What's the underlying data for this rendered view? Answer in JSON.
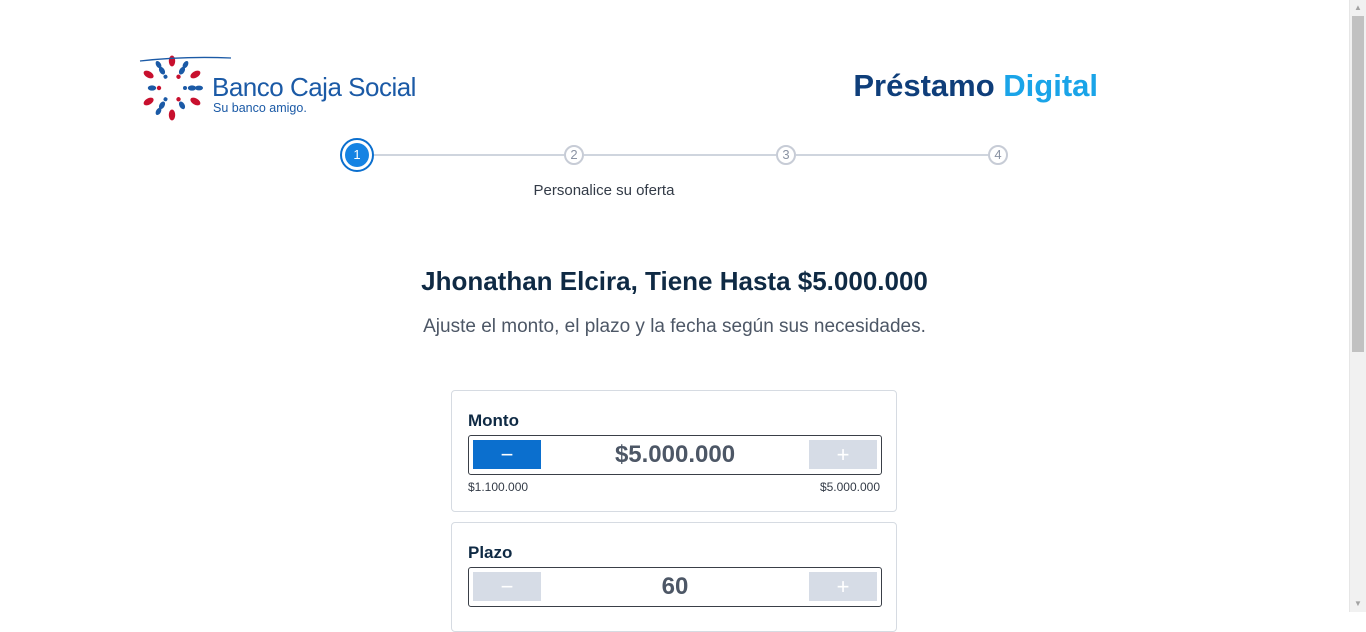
{
  "brand": {
    "name": "Banco Caja Social",
    "tagline": "Su banco amigo."
  },
  "product": {
    "title_part1": "Préstamo",
    "title_part2": "Digital"
  },
  "stepper": {
    "steps": [
      "1",
      "2",
      "3",
      "4"
    ],
    "active_step": 1,
    "active_label": "Personalice su oferta"
  },
  "offer": {
    "heading": "Jhonathan Elcira, Tiene Hasta $5.000.000",
    "subheading": "Ajuste el monto, el plazo y la fecha según sus necesidades."
  },
  "monto": {
    "label": "Monto",
    "value": "$5.000.000",
    "min": "$1.100.000",
    "max": "$5.000.000",
    "minus_label": "−",
    "plus_label": "+"
  },
  "plazo": {
    "label": "Plazo",
    "value": "60",
    "minus_label": "−",
    "plus_label": "+"
  },
  "colors": {
    "primary": "#0b6fce",
    "brand_dark": "#0f3e7a",
    "brand_light": "#1aa4e8",
    "disabled": "#d6dce6"
  }
}
